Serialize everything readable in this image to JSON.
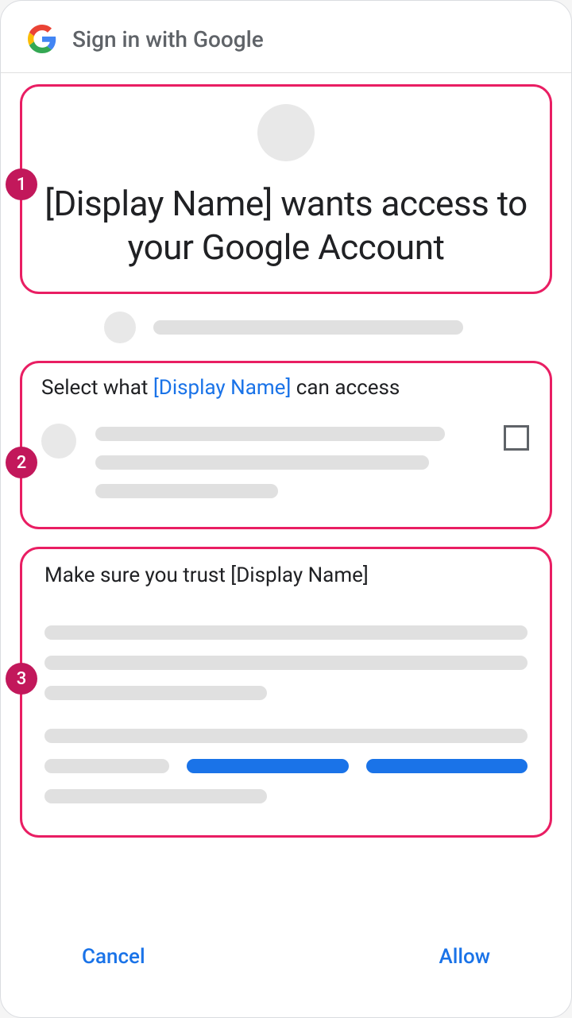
{
  "header": {
    "title": "Sign in with Google"
  },
  "annotations": {
    "badge1": "1",
    "badge2": "2",
    "badge3": "3"
  },
  "section1": {
    "headline": "[Display Name] wants access to your Google Account"
  },
  "section2": {
    "title_prefix": "Select what ",
    "title_name": "[Display Name]",
    "title_suffix": " can access"
  },
  "section3": {
    "title": "Make sure you trust [Display Name]"
  },
  "footer": {
    "cancel": "Cancel",
    "allow": "Allow"
  }
}
